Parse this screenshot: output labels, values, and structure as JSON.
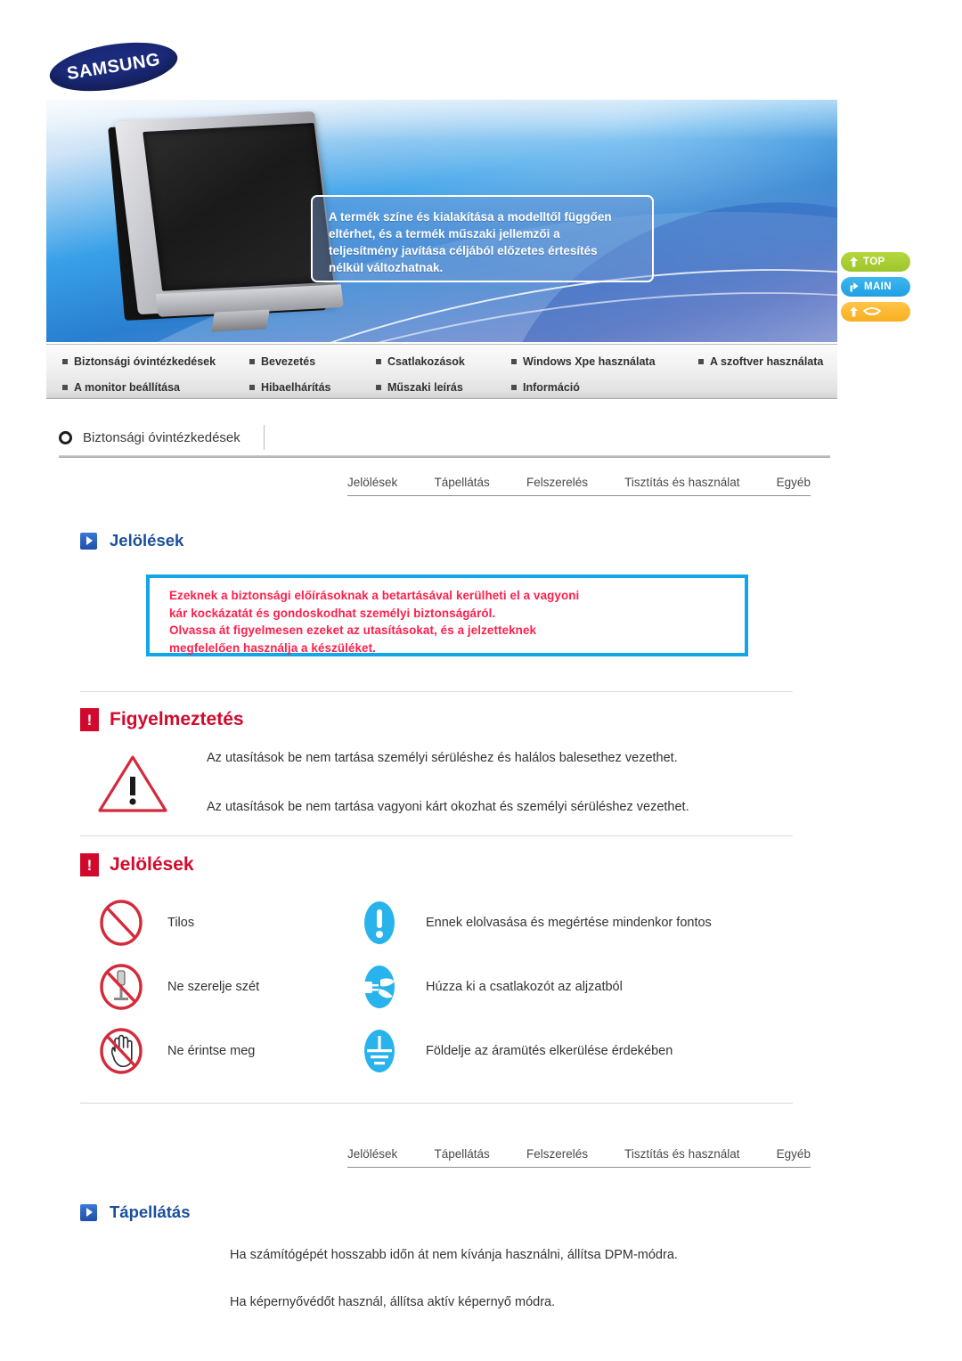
{
  "brand": {
    "logo_text": "SAMSUNG"
  },
  "banner": {
    "note_lines": [
      "A termék színe és kialakítása a modelltől függően",
      "eltérhet, és a termék műszaki jellemzői a",
      "teljesítmény javítása céljából előzetes értesítés",
      "nélkül változhatnak."
    ],
    "monitor_alt": "lcd-monitor-illustration"
  },
  "quicknav": [
    {
      "label": "TOP",
      "icon": "arrow-up-icon",
      "color": "#9ec62c"
    },
    {
      "label": "MAIN",
      "icon": "arrow-turn-up-icon",
      "color": "#1fa0e3"
    },
    {
      "label": "",
      "icon": "book-icon",
      "color": "#f7ae1e"
    }
  ],
  "nav": {
    "row1": [
      "Biztonsági óvintézkedések",
      "Bevezetés",
      "Csatlakozások",
      "Windows Xpe használata",
      "A szoftver használata"
    ],
    "row2": [
      "A monitor beállítása",
      "Hibaelhárítás",
      "Műszaki leírás",
      "Információ"
    ]
  },
  "breadcrumb": {
    "icon": "ring-icon",
    "label": "Biztonsági óvintézkedések"
  },
  "tabs": [
    "Jelölések",
    "Tápellátás",
    "Felszerelés",
    "Tisztítás és használat",
    "Egyéb"
  ],
  "sections": {
    "jelolesek_heading": "Jelölések",
    "tapellatas_heading": "Tápellátás"
  },
  "notice": {
    "lines": [
      "Ezeknek a biztonsági előírásoknak a betartásával kerülheti el a vagyoni",
      "kár kockázatát és gondoskodhat személyi biztonságáról.",
      "Olvassa át figyelmesen ezeket az utasításokat, és a jelzetteknek",
      "megfelelően használja a készüléket."
    ],
    "text_color": "#ff1f4b",
    "border_color": "#12a5e8"
  },
  "warning": {
    "badge": "!",
    "title": "Figyelmeztetés",
    "icon": "warning-triangle-icon",
    "lines": [
      "Az utasítások be nem tartása személyi sérüléshez és halálos balesethez vezethet.",
      "Az utasítások be nem tartása vagyoni kárt okozhat és személyi sérüléshez vezethet."
    ]
  },
  "symbols": {
    "badge": "!",
    "title": "Jelölések",
    "rows": [
      {
        "left": {
          "icon": "prohibited-icon",
          "label": "Tilos"
        },
        "right": {
          "icon": "exclamation-mandatory-icon",
          "label": "Ennek elolvasása és megértése mindenkor fontos"
        }
      },
      {
        "left": {
          "icon": "no-disassembly-icon",
          "label": "Ne szerelje szét"
        },
        "right": {
          "icon": "unplug-mandatory-icon",
          "label": "Húzza ki a csatlakozót az aljzatból"
        }
      },
      {
        "left": {
          "icon": "do-not-touch-icon",
          "label": "Ne érintse meg"
        },
        "right": {
          "icon": "grounding-mandatory-icon",
          "label": "Földelje az áramütés elkerülése érdekében"
        }
      }
    ],
    "prohibition_color": "#d42b3c",
    "mandatory_color": "#29b3ec"
  },
  "power": {
    "lines": [
      "Ha számítógépét hosszabb időn át nem kívánja használni, állítsa DPM-módra.",
      "Ha képernyővédőt használ, állítsa aktív képernyő módra."
    ]
  }
}
